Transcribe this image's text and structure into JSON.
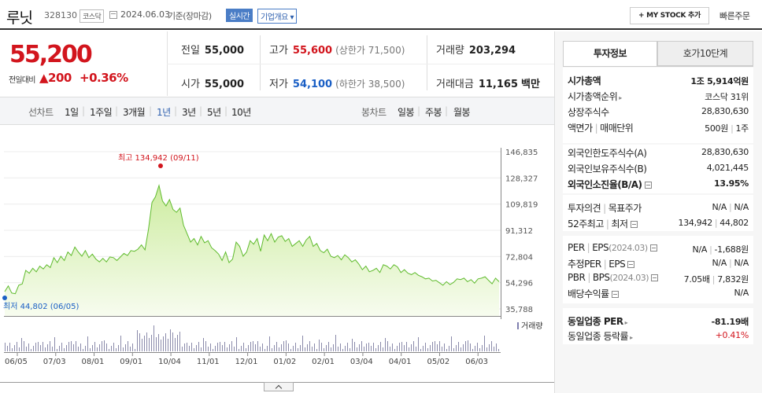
{
  "header": {
    "name": "루닛",
    "code": "328130",
    "market": "코스닥",
    "date": "2024.06.03",
    "basis": "기준(장마감)",
    "realtime": "실시간",
    "company_overview": "기업개요 ▾",
    "my_stock": "+ MY STOCK 추가",
    "quick_order": "빠른주문"
  },
  "price": {
    "current": "55,200",
    "change_label": "전일대비",
    "change": "▲200",
    "change_pct": "+0.36%"
  },
  "quote": {
    "prev_close_label": "전일",
    "prev_close": "55,000",
    "high_label": "고가",
    "high": "55,600",
    "upper_limit": "(상한가 71,500)",
    "volume_label": "거래량",
    "volume": "203,294",
    "open_label": "시가",
    "open": "55,000",
    "low_label": "저가",
    "low": "54,100",
    "lower_limit": "(하한가 38,500)",
    "amount_label": "거래대금",
    "amount": "11,165",
    "amount_unit": "백만"
  },
  "periods": {
    "line_label": "선차트",
    "line_options": [
      "1일",
      "1주일",
      "3개월",
      "1년",
      "3년",
      "5년",
      "10년"
    ],
    "selected": "1년",
    "candle_label": "봉차트",
    "candle_options": [
      "일봉",
      "주봉",
      "월봉"
    ]
  },
  "chart_data": {
    "type": "area",
    "y_ticks": [
      "146,835",
      "128,327",
      "109,819",
      "91,312",
      "72,804",
      "54,296",
      "35,788"
    ],
    "ylim": [
      35788,
      146835
    ],
    "x_ticks": [
      "06/05",
      "07/03",
      "08/01",
      "09/01",
      "10/04",
      "11/01",
      "12/01",
      "01/02",
      "02/01",
      "03/04",
      "04/01",
      "05/02",
      "06/03"
    ],
    "high_annotation": "최고 134,942 (09/11)",
    "low_annotation": "최저 44,802 (06/05)",
    "volume_legend": "거래량",
    "series": [
      {
        "values": [
          48000,
          52000,
          47000,
          46500,
          52500,
          53500,
          63000,
          61000,
          64500,
          62000,
          66000,
          64000,
          67000,
          65000,
          72000,
          68500,
          73000,
          70000,
          76000,
          73500,
          79500,
          76000,
          73000,
          77000,
          72000,
          74500,
          71000,
          69000,
          71500,
          69000,
          72500,
          72000,
          70000,
          72500,
          75000,
          73500,
          77000,
          76500,
          78000,
          81000,
          77500,
          92000,
          111000,
          115000,
          123000,
          112000,
          108500,
          113000,
          106000,
          104000,
          107000,
          95000,
          89000,
          83000,
          85500,
          81000,
          87000,
          82500,
          84000,
          79000,
          77000,
          74500,
          70000,
          76000,
          68500,
          71000,
          83000,
          80000,
          73000,
          76000,
          84000,
          81500,
          85500,
          76500,
          88000,
          84000,
          89000,
          83000,
          86500,
          87500,
          83500,
          85500,
          80000,
          82000,
          84000,
          80000,
          84500,
          87000,
          80000,
          82000,
          77000,
          75500,
          78000,
          73000,
          72000,
          73500,
          70500,
          74000,
          72000,
          69000,
          70500,
          67500,
          63500,
          66000,
          62000,
          63000,
          64500,
          61500,
          67000,
          66000,
          64000,
          67000,
          65500,
          61500,
          63500,
          61000,
          60000,
          61500,
          59500,
          58500,
          57000,
          57500,
          55500,
          56000,
          54200,
          52500,
          55000,
          53000,
          54500,
          57000,
          56500,
          57500,
          55000,
          56500,
          54000,
          57000,
          57500,
          58500,
          56000,
          53500,
          57500,
          55000
        ]
      }
    ]
  },
  "panel": {
    "tab_info": "투자정보",
    "tab_orderbook": "호가10단계",
    "rows": {
      "market_cap_label": "시가총액",
      "market_cap": "1조 5,914억원",
      "cap_rank_label": "시가총액순위",
      "cap_rank": "코스닥 31위",
      "shares_label": "상장주식수",
      "shares": "28,830,630",
      "par_label": "액면가",
      "par_sep": "|",
      "unit_label": "매매단위",
      "par_value": "500원",
      "unit_value": "1주",
      "foreign_limit_label": "외국인한도주식수(A)",
      "foreign_limit": "28,830,630",
      "foreign_hold_label": "외국인보유주식수(B)",
      "foreign_hold": "4,021,445",
      "foreign_ratio_label": "외국인소진율(B/A)",
      "foreign_ratio": "13.95%",
      "opinion_label": "투자의견",
      "target_label": "목표주가",
      "opinion": "N/A",
      "target": "N/A",
      "w52_label": "52주최고",
      "w52_low_label": "최저",
      "w52_high": "134,942",
      "w52_low": "44,802",
      "per_label": "PER",
      "eps_label": "EPS",
      "eps_period": "(2024.03)",
      "per": "N/A",
      "eps": "-1,688원",
      "est_per_label": "추정PER",
      "est_eps_label": "EPS",
      "est_per": "N/A",
      "est_eps": "N/A",
      "pbr_label": "PBR",
      "bps_label": "BPS",
      "bps_period": "(2024.03)",
      "pbr": "7.05배",
      "bps": "7,832원",
      "div_label": "배당수익률",
      "div": "N/A",
      "ind_per_label": "동일업종 PER",
      "ind_per": "-81.19배",
      "ind_chg_label": "동일업종 등락률",
      "ind_chg": "+0.41%"
    }
  }
}
